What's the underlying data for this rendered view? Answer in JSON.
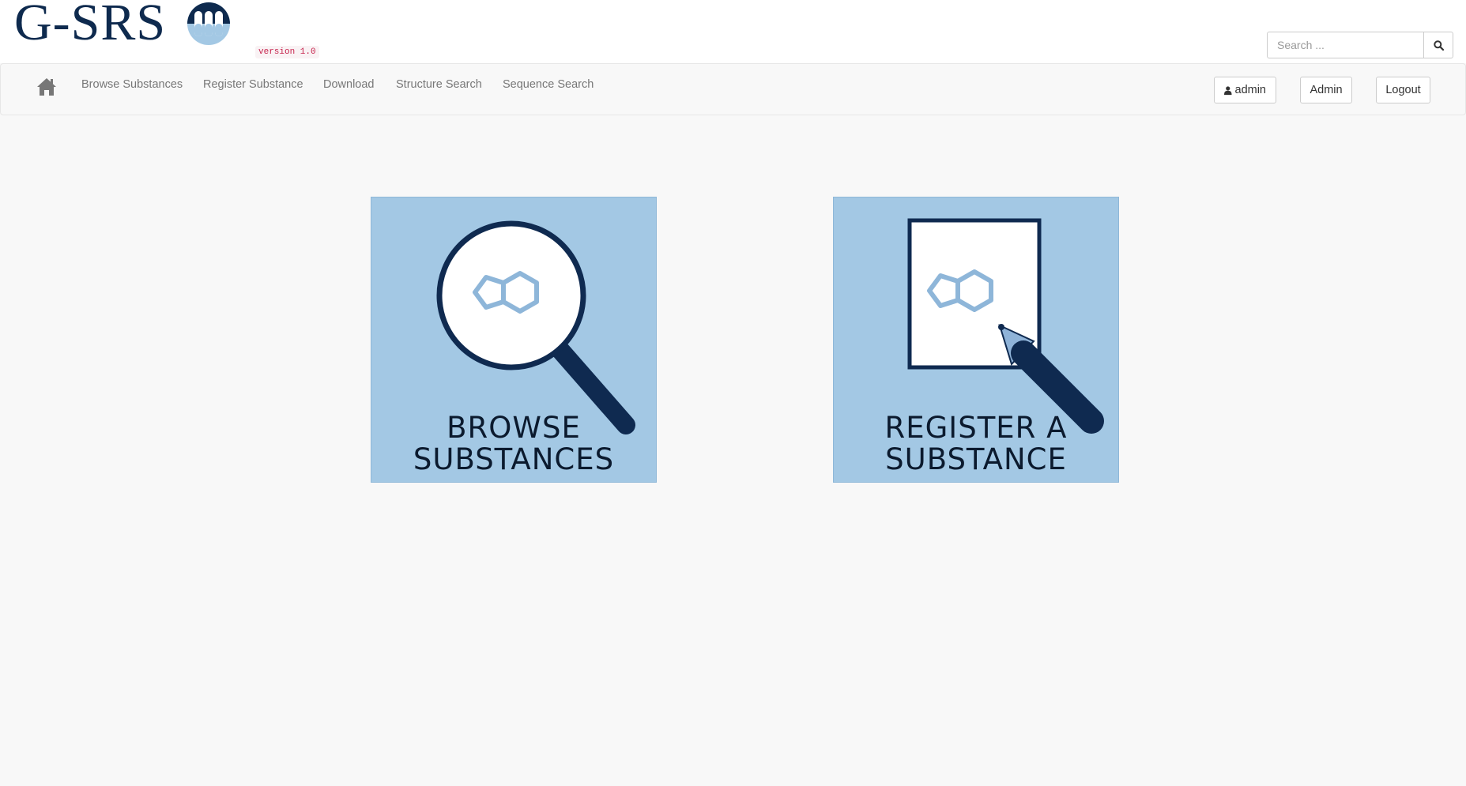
{
  "header": {
    "logo_text": "G-SRS",
    "version": "version 1.0",
    "search": {
      "placeholder": "Search ..."
    }
  },
  "nav": {
    "links": [
      "Browse Substances",
      "Register Substance",
      "Download",
      "Structure Search",
      "Sequence Search"
    ],
    "user_button": "admin",
    "admin_button": "Admin",
    "logout_button": "Logout"
  },
  "tiles": {
    "browse": {
      "line1": "BROWSE",
      "line2": "SUBSTANCES"
    },
    "register": {
      "line1": "REGISTER A",
      "line2": "SUBSTANCE"
    }
  },
  "colors": {
    "brand_navy": "#0e2a4e",
    "tile_blue": "#a3c8e4",
    "molecule_blue": "#8eb6d9"
  },
  "icons": [
    "home-icon",
    "search-icon",
    "user-icon",
    "magnifier-icon",
    "pencil-icon",
    "molecule-icon"
  ]
}
